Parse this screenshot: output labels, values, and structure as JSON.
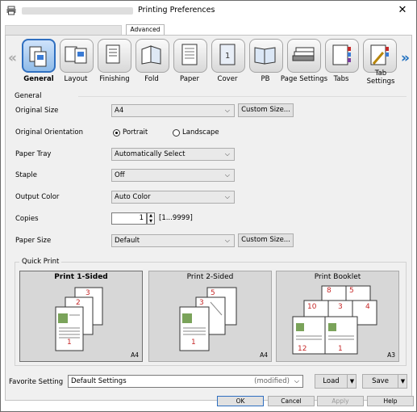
{
  "window": {
    "title": "Printing Preferences",
    "close_glyph": "✕"
  },
  "tabs": {
    "advanced": "Advanced"
  },
  "toolbar": {
    "items": [
      {
        "label": "General",
        "icon": "general-icon"
      },
      {
        "label": "Layout",
        "icon": "layout-icon"
      },
      {
        "label": "Finishing",
        "icon": "finishing-icon"
      },
      {
        "label": "Fold",
        "icon": "fold-icon"
      },
      {
        "label": "Paper",
        "icon": "paper-icon"
      },
      {
        "label": "Cover",
        "icon": "cover-icon"
      },
      {
        "label": "PB",
        "icon": "pb-icon"
      },
      {
        "label": "Page Settings",
        "icon": "page-settings-icon"
      },
      {
        "label": "Tabs",
        "icon": "tabs-icon"
      },
      {
        "label": "Tab Settings",
        "icon": "tab-settings-icon"
      }
    ],
    "left_arrow": "«",
    "right_arrow": "»"
  },
  "general": {
    "section": "General",
    "original_size": {
      "label": "Original Size",
      "value": "A4",
      "button": "Custom Size..."
    },
    "orientation": {
      "label": "Original Orientation",
      "portrait": "Portrait",
      "landscape": "Landscape",
      "selected": "Portrait"
    },
    "paper_tray": {
      "label": "Paper Tray",
      "value": "Automatically Select"
    },
    "staple": {
      "label": "Staple",
      "value": "Off"
    },
    "output_color": {
      "label": "Output Color",
      "value": "Auto Color"
    },
    "copies": {
      "label": "Copies",
      "value": "1",
      "range": "[1...9999]"
    },
    "paper_size": {
      "label": "Paper Size",
      "value": "Default",
      "button": "Custom Size..."
    }
  },
  "quick_print": {
    "title": "Quick Print",
    "cards": [
      {
        "name": "Print 1-Sided",
        "size": "A4",
        "pages": [
          "3",
          "2",
          "1"
        ]
      },
      {
        "name": "Print 2-Sided",
        "size": "A4",
        "pages": [
          "5",
          "3",
          "1"
        ]
      },
      {
        "name": "Print Booklet",
        "size": "A3",
        "pages": [
          "8",
          "5",
          "10",
          "3",
          "4",
          "12",
          "1"
        ]
      }
    ]
  },
  "favorite": {
    "label": "Favorite Setting",
    "value": "Default Settings",
    "modified": "(modified)",
    "load": "Load",
    "save": "Save"
  },
  "dialog": {
    "ok": "OK",
    "cancel": "Cancel",
    "apply": "Apply",
    "help": "Help"
  },
  "colors": {
    "accent": "#2f6fc0",
    "page_number": "#c62828",
    "panel": "#f0f0f0"
  }
}
